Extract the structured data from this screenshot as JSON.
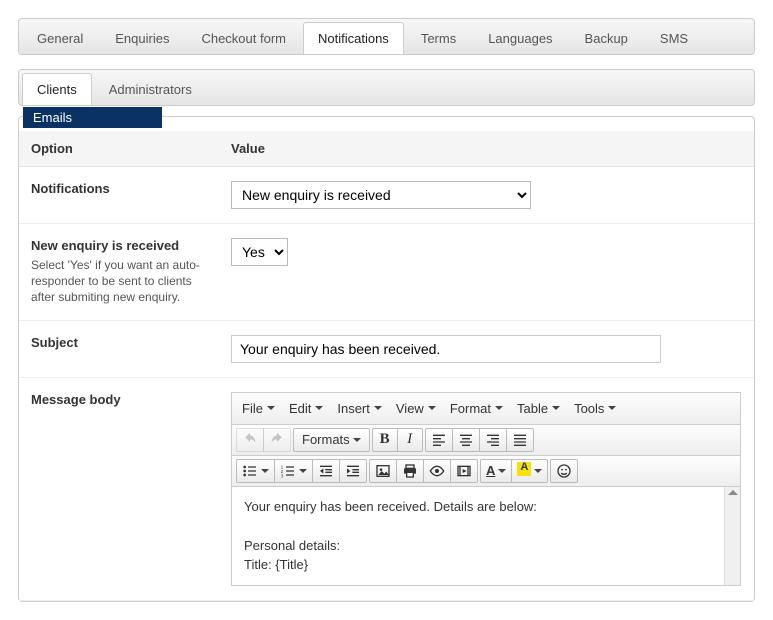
{
  "top_tabs": [
    "General",
    "Enquiries",
    "Checkout form",
    "Notifications",
    "Terms",
    "Languages",
    "Backup",
    "SMS"
  ],
  "top_active": 3,
  "sub_tabs": [
    "Clients",
    "Administrators"
  ],
  "sub_active": 0,
  "legend": "Emails",
  "columns": {
    "option": "Option",
    "value": "Value"
  },
  "rows": {
    "notifications": {
      "label": "Notifications",
      "selected": "New enquiry is received"
    },
    "new_enquiry": {
      "label": "New enquiry is received",
      "desc": "Select 'Yes' if you want an auto-responder to be sent to clients after submiting new enquiry.",
      "selected": "Yes"
    },
    "subject": {
      "label": "Subject",
      "value": "Your enquiry has been received."
    },
    "body": {
      "label": "Message body",
      "content": "Your enquiry has been received. Details are below:\n\nPersonal details:\nTitle: {Title}"
    }
  },
  "editor": {
    "menus": [
      "File",
      "Edit",
      "Insert",
      "View",
      "Format",
      "Table",
      "Tools"
    ],
    "formats_label": "Formats"
  }
}
